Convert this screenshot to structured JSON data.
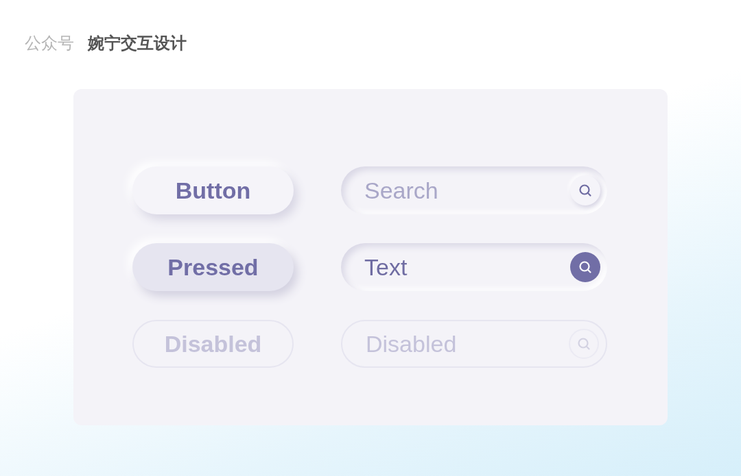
{
  "header": {
    "label": "公众号",
    "title": "婉宁交互设计"
  },
  "buttons": [
    {
      "label": "Button",
      "kind": "normal"
    },
    {
      "label": "Pressed",
      "kind": "pressed"
    },
    {
      "label": "Disabled",
      "kind": "disabled"
    }
  ],
  "fields": [
    {
      "placeholder": "Search",
      "kind": "normal"
    },
    {
      "value": "Text",
      "kind": "active"
    },
    {
      "placeholder": "Disabled",
      "kind": "disabled"
    }
  ]
}
